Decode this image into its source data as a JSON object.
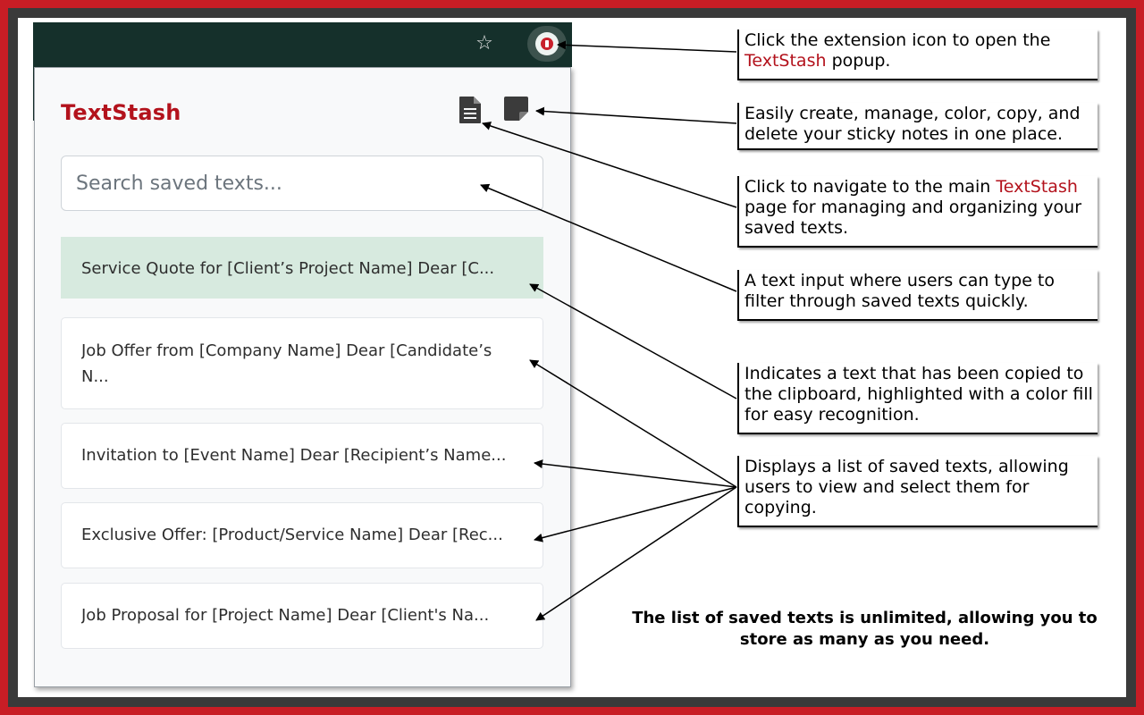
{
  "colors": {
    "frame": "#c81d25",
    "toolbar": "#15302b",
    "brand": "#b3121c",
    "copied_highlight": "#d7eadf"
  },
  "toolbar": {
    "bookmark_icon": "star-icon",
    "extension_icon": "textstash-extension-icon"
  },
  "popup": {
    "title": "TextStash",
    "open_main_page_icon": "document-icon",
    "sticky_notes_icon": "sticky-note-icon",
    "search": {
      "placeholder": "Search saved texts..."
    },
    "items": [
      {
        "text": "Service Quote for [Client’s Project Name] Dear [C...",
        "copied": true
      },
      {
        "text": "Job Offer from [Company Name] Dear [Candidate’s N...",
        "copied": false
      },
      {
        "text": "Invitation to [Event Name] Dear [Recipient’s Name...",
        "copied": false
      },
      {
        "text": "Exclusive Offer: [Product/Service Name] Dear [Rec...",
        "copied": false
      },
      {
        "text": "Job Proposal for [Project Name] Dear [Client's Na...",
        "copied": false
      }
    ]
  },
  "callouts": {
    "extension": {
      "before": "Click the extension icon to open the",
      "accent": "TextStash",
      "after": " popup."
    },
    "notes": {
      "text": "Easily create, manage, color, copy, and delete your sticky notes in one place."
    },
    "main_page": {
      "before": "Click to navigate to the main ",
      "accent": "TextStash",
      "after": " page for managing and organizing your saved texts."
    },
    "search": {
      "text": "A text input where users can type to filter through saved texts quickly."
    },
    "copied": {
      "text": "Indicates a text that has been copied to the clipboard, highlighted with a color fill for easy recognition."
    },
    "list": {
      "text": "Displays a list of saved texts, allowing users to view and select them for copying."
    }
  },
  "footnote": "The list of saved texts is unlimited, allowing you to store as many as you need."
}
